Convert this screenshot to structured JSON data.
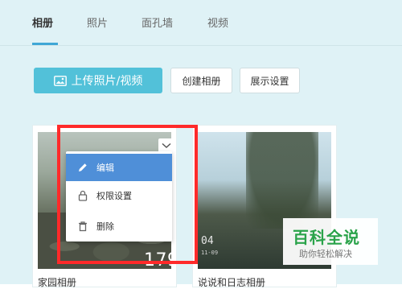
{
  "tabs": [
    {
      "label": "相册",
      "active": true
    },
    {
      "label": "照片",
      "active": false
    },
    {
      "label": "面孔墙",
      "active": false
    },
    {
      "label": "视频",
      "active": false
    }
  ],
  "actions": {
    "upload_label": "上传照片/视频",
    "create_album_label": "创建相册",
    "display_settings_label": "展示设置"
  },
  "albums": [
    {
      "title": "家园相册",
      "count": "179"
    },
    {
      "title": "说说和日志相册",
      "stamp": "04",
      "stamp_date": "11-09"
    }
  ],
  "menu": {
    "items": [
      {
        "label": "编辑",
        "icon": "pencil-icon",
        "selected": true
      },
      {
        "label": "权限设置",
        "icon": "lock-icon",
        "selected": false
      },
      {
        "label": "删除",
        "icon": "trash-icon",
        "selected": false
      }
    ]
  },
  "watermark": {
    "title": "百科全说",
    "subtitle": "助你轻松解决"
  },
  "colors": {
    "accent": "#52c1d9",
    "menu_selected": "#4f8fd8",
    "highlight": "#ff2a2a",
    "watermark_green": "#2aa34a"
  }
}
